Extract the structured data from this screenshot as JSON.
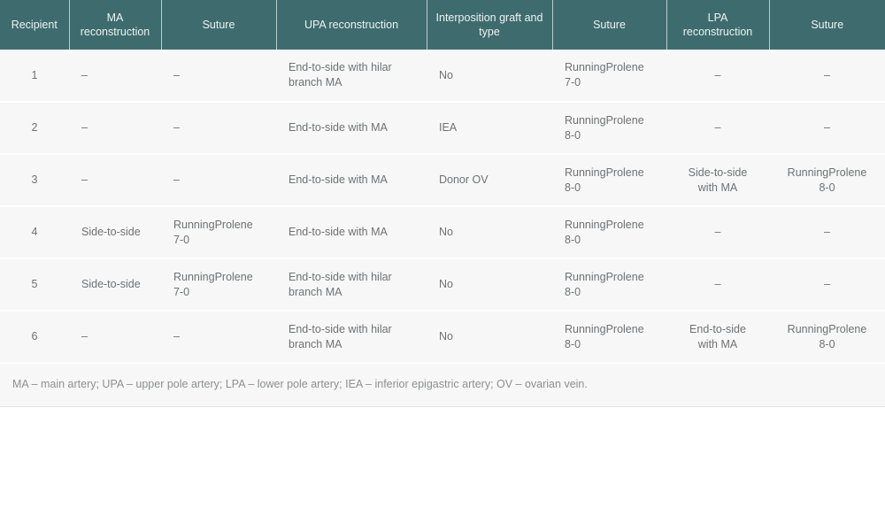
{
  "table": {
    "columns": [
      {
        "key": "recipient",
        "label": "Recipient",
        "align": "center"
      },
      {
        "key": "ma_recon",
        "label": "MA reconstruction",
        "align": "left"
      },
      {
        "key": "ma_suture",
        "label": "Suture",
        "align": "left"
      },
      {
        "key": "upa_recon",
        "label": "UPA reconstruction",
        "align": "left"
      },
      {
        "key": "graft",
        "label": "Interposition graft and type",
        "align": "left"
      },
      {
        "key": "upa_suture",
        "label": "Suture",
        "align": "left"
      },
      {
        "key": "lpa_recon",
        "label": "LPA reconstruction",
        "align": "center"
      },
      {
        "key": "lpa_suture",
        "label": "Suture",
        "align": "center"
      }
    ],
    "rows": [
      {
        "recipient": "1",
        "ma_recon": "–",
        "ma_suture_name": "",
        "ma_suture_size": "–",
        "upa_recon": "End-to-side with hilar branch MA",
        "graft": "No",
        "upa_suture_name": "RunningProlene",
        "upa_suture_size": "7-0",
        "lpa_recon": "–",
        "lpa_suture_name": "",
        "lpa_suture_size": "–"
      },
      {
        "recipient": "2",
        "ma_recon": "–",
        "ma_suture_name": "",
        "ma_suture_size": "–",
        "upa_recon": "End-to-side with MA",
        "graft": "IEA",
        "upa_suture_name": "RunningProlene",
        "upa_suture_size": "8-0",
        "lpa_recon": "–",
        "lpa_suture_name": "",
        "lpa_suture_size": "–"
      },
      {
        "recipient": "3",
        "ma_recon": "–",
        "ma_suture_name": "",
        "ma_suture_size": "–",
        "upa_recon": "End-to-side with MA",
        "graft": "Donor OV",
        "upa_suture_name": "RunningProlene",
        "upa_suture_size": "8-0",
        "lpa_recon": "Side-to-side with MA",
        "lpa_suture_name": "RunningProlene",
        "lpa_suture_size": "8-0"
      },
      {
        "recipient": "4",
        "ma_recon": "Side-to-side",
        "ma_suture_name": "RunningProlene",
        "ma_suture_size": "7-0",
        "upa_recon": "End-to-side with MA",
        "graft": "No",
        "upa_suture_name": "RunningProlene",
        "upa_suture_size": "8-0",
        "lpa_recon": "–",
        "lpa_suture_name": "",
        "lpa_suture_size": "–"
      },
      {
        "recipient": "5",
        "ma_recon": "Side-to-side",
        "ma_suture_name": "RunningProlene",
        "ma_suture_size": "7-0",
        "upa_recon": "End-to-side with hilar branch MA",
        "graft": "No",
        "upa_suture_name": "RunningProlene",
        "upa_suture_size": "8-0",
        "lpa_recon": "–",
        "lpa_suture_name": "",
        "lpa_suture_size": "–"
      },
      {
        "recipient": "6",
        "ma_recon": "–",
        "ma_suture_name": "",
        "ma_suture_size": "–",
        "upa_recon": "End-to-side with hilar branch MA",
        "graft": "No",
        "upa_suture_name": "RunningProlene",
        "upa_suture_size": "8-0",
        "lpa_recon": "End-to-side with MA",
        "lpa_suture_name": "RunningProlene",
        "lpa_suture_size": "8-0"
      }
    ],
    "footnote": "MA – main artery; UPA – upper pole artery; LPA – lower pole artery; IEA – inferior epigastric artery; OV – ovarian vein."
  },
  "colors": {
    "header_background": "#3e6b6e",
    "header_text": "#eef3f3",
    "row_background": "#f7f7f7",
    "row_separator": "#ffffff",
    "body_text": "#6f7173",
    "footnote_text": "#8d8f91"
  }
}
